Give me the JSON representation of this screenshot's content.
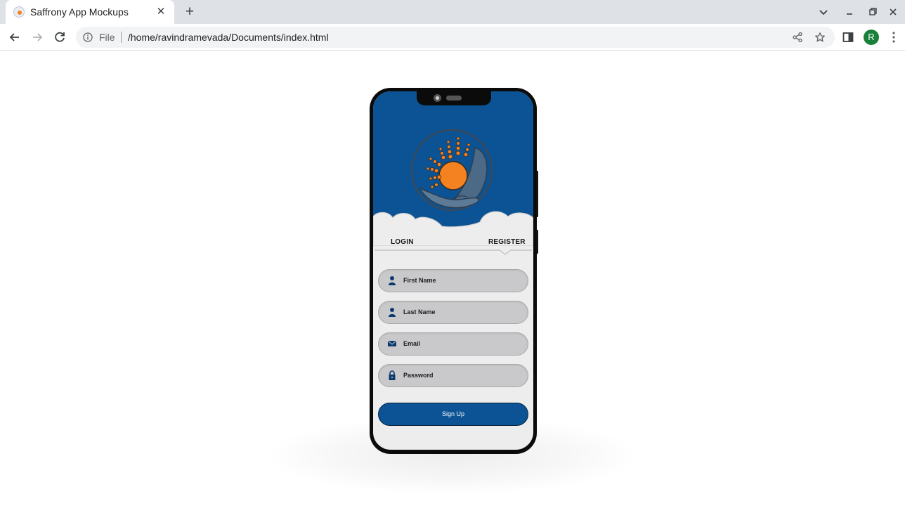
{
  "browser": {
    "tab_title": "Saffrony App Mockups",
    "tab_close": "✕",
    "new_tab": "+",
    "scheme_label": "File",
    "url": "/home/ravindramevada/Documents/index.html",
    "profile_initial": "R",
    "icons": [
      "back-arrow-icon",
      "forward-arrow-icon",
      "reload-icon",
      "info-icon",
      "share-icon",
      "star-icon",
      "side-panel-icon",
      "menu-icon"
    ]
  },
  "app": {
    "tabs": {
      "login": "LOGIN",
      "register": "REGISTER"
    },
    "active_tab": "register",
    "fields": {
      "first_name": "First Name",
      "last_name": "Last Name",
      "email": "Email",
      "password": "Password"
    },
    "signup_label": "Sign Up",
    "colors": {
      "primary": "#0b5394",
      "sun": "#f58220",
      "field": "#c9c9cb",
      "screen": "#ededee"
    }
  }
}
